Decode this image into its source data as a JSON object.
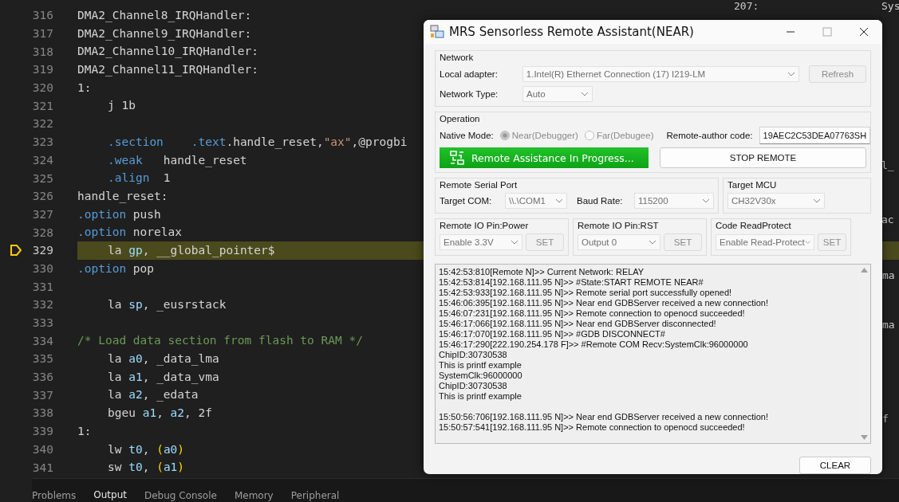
{
  "editor": {
    "lines": [
      {
        "number": "316",
        "current": false,
        "indented": false,
        "segments": [
          {
            "text": "DMA2_Channel8_IRQHandler:",
            "kind": "plain"
          }
        ]
      },
      {
        "number": "317",
        "current": false,
        "indented": false,
        "segments": [
          {
            "text": "DMA2_Channel9_IRQHandler:",
            "kind": "plain"
          }
        ]
      },
      {
        "number": "318",
        "current": false,
        "indented": false,
        "segments": [
          {
            "text": "DMA2_Channel10_IRQHandler:",
            "kind": "plain"
          }
        ]
      },
      {
        "number": "319",
        "current": false,
        "indented": false,
        "segments": [
          {
            "text": "DMA2_Channel11_IRQHandler:",
            "kind": "plain"
          }
        ]
      },
      {
        "number": "320",
        "current": false,
        "indented": false,
        "segments": [
          {
            "text": "1:",
            "kind": "plain"
          }
        ]
      },
      {
        "number": "321",
        "current": false,
        "indented": true,
        "segments": [
          {
            "text": "j 1b",
            "kind": "plain"
          }
        ]
      },
      {
        "number": "322",
        "current": false
      },
      {
        "number": "323",
        "current": false,
        "indented": true,
        "segments": [
          {
            "text": ".section",
            "kind": "directive"
          },
          {
            "text": "    .text",
            "kind": "directive"
          },
          {
            "text": ".handle_reset,",
            "kind": "plain"
          },
          {
            "text": "\"ax\"",
            "kind": "string"
          },
          {
            "text": ",@progbi",
            "kind": "plain"
          }
        ]
      },
      {
        "number": "324",
        "current": false,
        "indented": true,
        "segments": [
          {
            "text": ".weak",
            "kind": "directive"
          },
          {
            "text": "   handle_reset",
            "kind": "plain"
          }
        ]
      },
      {
        "number": "325",
        "current": false,
        "indented": true,
        "segments": [
          {
            "text": ".align",
            "kind": "directive"
          },
          {
            "text": "  1",
            "kind": "plain"
          }
        ]
      },
      {
        "number": "326",
        "current": false,
        "indented": false,
        "segments": [
          {
            "text": "handle_reset:",
            "kind": "plain"
          }
        ]
      },
      {
        "number": "327",
        "current": false,
        "indented": false,
        "segments": [
          {
            "text": ".option",
            "kind": "directive"
          },
          {
            "text": " push",
            "kind": "plain"
          }
        ]
      },
      {
        "number": "328",
        "current": false,
        "indented": false,
        "segments": [
          {
            "text": ".option",
            "kind": "directive"
          },
          {
            "text": " norelax",
            "kind": "plain"
          }
        ]
      },
      {
        "number": "329",
        "current": true,
        "indented": true,
        "segments": [
          {
            "text": "la ",
            "kind": "plain"
          },
          {
            "text": "gp",
            "kind": "register"
          },
          {
            "text": ", __global_pointer$",
            "kind": "plain"
          }
        ]
      },
      {
        "number": "330",
        "current": false,
        "indented": false,
        "segments": [
          {
            "text": ".option",
            "kind": "directive"
          },
          {
            "text": " pop",
            "kind": "plain"
          }
        ]
      },
      {
        "number": "331",
        "current": false
      },
      {
        "number": "332",
        "current": false,
        "indented": true,
        "segments": [
          {
            "text": "la ",
            "kind": "plain"
          },
          {
            "text": "sp",
            "kind": "register"
          },
          {
            "text": ", _eusrstack",
            "kind": "plain"
          }
        ]
      },
      {
        "number": "333",
        "current": false
      },
      {
        "number": "334",
        "current": false,
        "indented": false,
        "segments": [
          {
            "text": "/* Load data section from flash to RAM */",
            "kind": "comment"
          }
        ]
      },
      {
        "number": "335",
        "current": false,
        "indented": true,
        "segments": [
          {
            "text": "la ",
            "kind": "plain"
          },
          {
            "text": "a0",
            "kind": "register"
          },
          {
            "text": ", _data_lma",
            "kind": "plain"
          }
        ]
      },
      {
        "number": "336",
        "current": false,
        "indented": true,
        "segments": [
          {
            "text": "la ",
            "kind": "plain"
          },
          {
            "text": "a1",
            "kind": "register"
          },
          {
            "text": ", _data_vma",
            "kind": "plain"
          }
        ]
      },
      {
        "number": "337",
        "current": false,
        "indented": true,
        "segments": [
          {
            "text": "la ",
            "kind": "plain"
          },
          {
            "text": "a2",
            "kind": "register"
          },
          {
            "text": ", _edata",
            "kind": "plain"
          }
        ]
      },
      {
        "number": "338",
        "current": false,
        "indented": true,
        "segments": [
          {
            "text": "bgeu ",
            "kind": "plain"
          },
          {
            "text": "a1",
            "kind": "register"
          },
          {
            "text": ", ",
            "kind": "plain"
          },
          {
            "text": "a2",
            "kind": "register"
          },
          {
            "text": ", 2f",
            "kind": "plain"
          }
        ]
      },
      {
        "number": "339",
        "current": false,
        "indented": false,
        "segments": [
          {
            "text": "1:",
            "kind": "plain"
          }
        ]
      },
      {
        "number": "340",
        "current": false,
        "indented": true,
        "segments": [
          {
            "text": "lw ",
            "kind": "plain"
          },
          {
            "text": "t0",
            "kind": "register"
          },
          {
            "text": ", ",
            "kind": "plain"
          },
          {
            "text": "(",
            "kind": "paren"
          },
          {
            "text": "a0",
            "kind": "register"
          },
          {
            "text": ")",
            "kind": "paren"
          }
        ]
      },
      {
        "number": "341",
        "current": false,
        "indented": true,
        "segments": [
          {
            "text": "sw ",
            "kind": "plain"
          },
          {
            "text": "t0",
            "kind": "register"
          },
          {
            "text": ", ",
            "kind": "plain"
          },
          {
            "text": "(",
            "kind": "paren"
          },
          {
            "text": "a1",
            "kind": "register"
          },
          {
            "text": ")",
            "kind": "paren"
          }
        ]
      }
    ]
  },
  "side_fragments": [
    "207:",
    "Sys",
    "l_",
    "ac",
    "ma",
    "ma",
    "f"
  ],
  "panel_tabs": [
    {
      "label": "Problems",
      "selected": false
    },
    {
      "label": "Output",
      "selected": true
    },
    {
      "label": "Debug Console",
      "selected": false
    },
    {
      "label": "Memory",
      "selected": false
    },
    {
      "label": "Peripheral",
      "selected": false
    }
  ],
  "window": {
    "title": "MRS Sensorless Remote Assistant(NEAR)"
  },
  "network": {
    "title": "Network",
    "adapter_label": "Local adapter:",
    "adapter_value": "1.Intel(R) Ethernet Connection (17) I219-LM",
    "refresh_button": "Refresh",
    "type_label": "Network Type:",
    "type_value": "Auto"
  },
  "operation": {
    "title": "Operation",
    "mode_label": "Native Mode:",
    "modes": [
      {
        "label": "Near(Debugger)",
        "selected": true
      },
      {
        "label": "Far(Debugee)",
        "selected": false
      }
    ],
    "code_label": "Remote-author code:",
    "code_value": "19AEC2C53DEA07763SH",
    "progress_button": "Remote Assistance In Progress...",
    "stop_button": "STOP REMOTE"
  },
  "serial": {
    "title": "Remote Serial Port",
    "com_label": "Target COM:",
    "com_value": "\\\\.\\COM1",
    "baud_label": "Baud Rate:",
    "baud_value": "115200"
  },
  "target_mcu": {
    "title": "Target MCU",
    "value": "CH32V30x"
  },
  "io_groups": [
    {
      "title": "Remote IO Pin:Power",
      "value": "Enable 3.3V",
      "button": "SET"
    },
    {
      "title": "Remote IO Pin:RST",
      "value": "Output 0",
      "button": "SET"
    },
    {
      "title": "Code ReadProtect",
      "value": "Enable Read-Protect",
      "button": "SET"
    }
  ],
  "log": {
    "paragraphs": [
      {
        "lines": [
          "15:42:53:810[Remote N]>> Current Network: RELAY",
          "15:42:53:814[192.168.111.95 N]>> #State:START REMOTE NEAR#",
          "15:42:53:933[192.168.111.95 N]>> Remote serial port successfully opened!",
          "15:46:06:395[192.168.111.95 N]>> Near end GDBServer received a new connection!",
          "15:46:07:231[192.168.111.95 N]>> Remote connection to openocd succeeded!",
          "15:46:17:066[192.168.111.95 N]>> Near end GDBServer disconnected!",
          "15:46:17:070[192.168.111.95 N]>> #GDB DISCONNECT#",
          "15:46:17:290[222.190.254.178 F]>> #Remote COM Recv:SystemClk:96000000",
          "ChipID:30730538",
          "This is printf example",
          "SystemClk:96000000",
          "ChipID:30730538",
          "This is printf example"
        ]
      },
      {
        "lines": [
          "15:50:56:706[192.168.111.95 N]>> Near end GDBServer received a new connection!",
          "15:50:57:541[192.168.111.95 N]>> Remote connection to openocd succeeded!"
        ]
      }
    ]
  },
  "clear_button": "CLEAR"
}
